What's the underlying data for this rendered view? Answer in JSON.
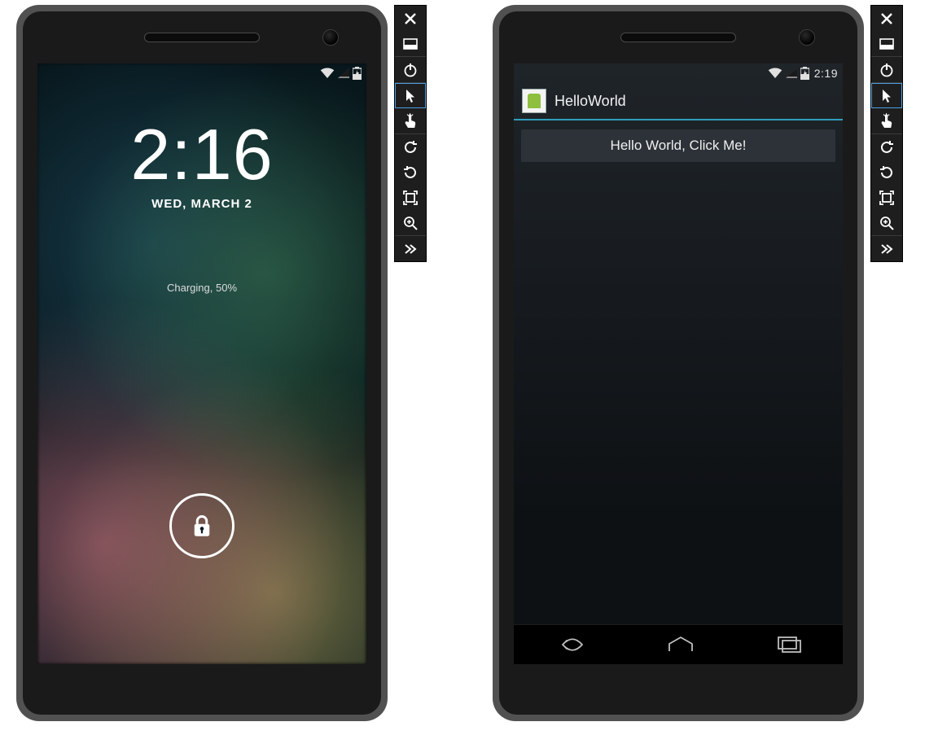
{
  "left": {
    "statusbar_time_visible": false,
    "clock_time": "2:16",
    "clock_date": "WED, MARCH 2",
    "charging_text": "Charging, 50%"
  },
  "right": {
    "statusbar_time": "2:19",
    "app_title": "HelloWorld",
    "button_label": "Hello World, Click Me!"
  },
  "toolbar": {
    "close": "Close",
    "minimize": "Minimize",
    "power": "Power",
    "cursor": "Cursor (selected)",
    "touch": "Touch",
    "rotate_ccw": "Rotate CCW",
    "rotate_cw": "Rotate CW",
    "screenshot": "Take screenshot",
    "zoom": "Zoom",
    "more": "More"
  }
}
